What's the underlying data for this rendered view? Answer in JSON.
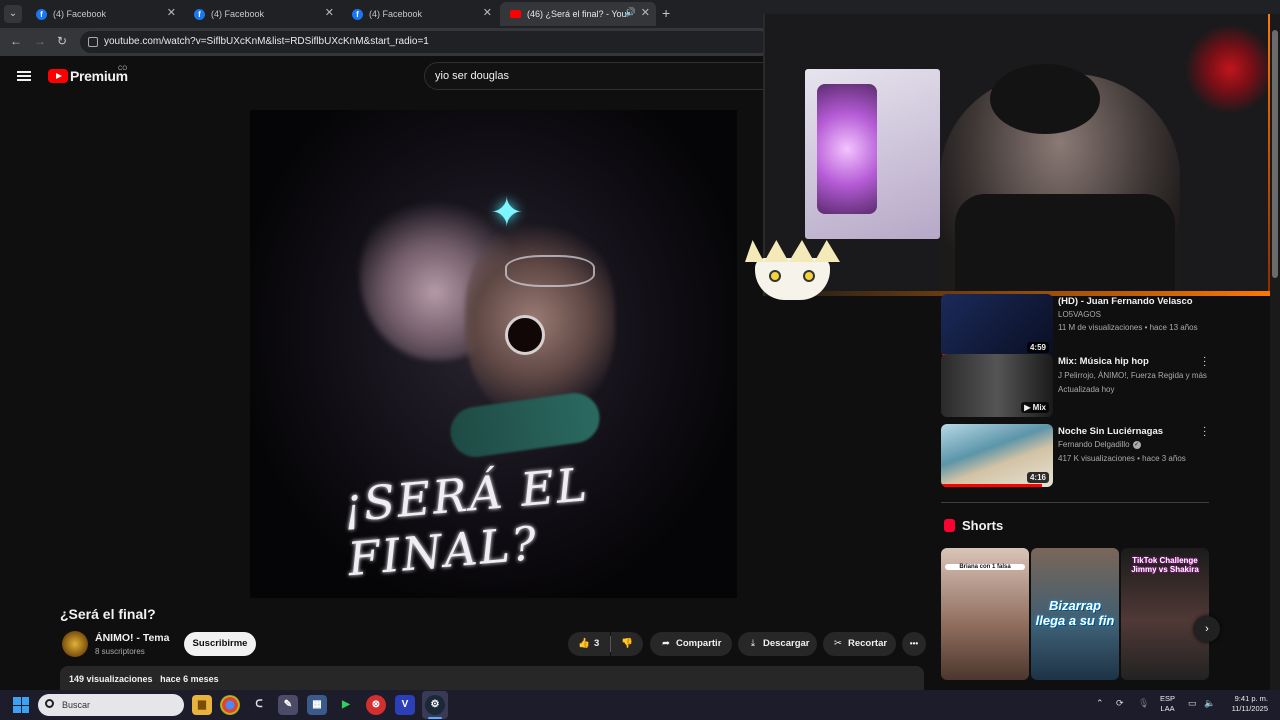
{
  "browser": {
    "tabs": [
      {
        "title": "(4) Facebook",
        "favicon": "facebook-icon",
        "active": false
      },
      {
        "title": "(4) Facebook",
        "favicon": "facebook-icon",
        "active": false
      },
      {
        "title": "(4) Facebook",
        "favicon": "facebook-icon",
        "active": false
      },
      {
        "title": "(46) ¿Será el final? - YouTube",
        "favicon": "youtube-icon",
        "active": true
      }
    ],
    "new_tab": "+",
    "url": "youtube.com/watch?v=SiflbUXcKnM&list=RDSiflbUXcKnM&start_radio=1"
  },
  "youtube": {
    "logo_text": "Premium",
    "country": "CO",
    "search_query": "yio ser douglas",
    "brand_color": "#ff0000"
  },
  "video": {
    "art_text": "¡SERÁ EL FINAL?",
    "title": "¿Será el final?",
    "channel": "ÁNIMO! - Tema",
    "subscribers": "8 suscriptores",
    "subscribe_label": "Suscribirme",
    "likes": "3",
    "share_label": "Compartir",
    "download_label": "Descargar",
    "clip_label": "Recortar",
    "more_label": "•••",
    "views": "149 visualizaciones",
    "published": "hace 6 meses"
  },
  "sidebar": {
    "recommendations": [
      {
        "title": "(HD) - Juan Fernando Velasco",
        "channel": "LO5VAGOS",
        "meta": "11 M de visualizaciones • hace 13 años",
        "duration": "4:59",
        "progress": 0.7
      },
      {
        "title": "Mix: Música hip hop",
        "channel": "J Pelirrojo, ÁNIMO!, Fuerza Regida y más",
        "meta": "Actualizada hoy",
        "duration": "Mix",
        "progress": 0
      },
      {
        "title": "Noche Sin Luciérnagas",
        "channel": "Fernando Delgadillo",
        "meta": "417 K visualizaciones • hace 3 años",
        "duration": "4:16",
        "progress": 0.9
      }
    ],
    "shorts_title": "Shorts",
    "shorts": [
      {
        "caption": "Briana con 1 falsa"
      },
      {
        "caption": "Bizarrap llega a su fin"
      },
      {
        "caption": "TikTok Challenge Jimmy vs Shakira"
      }
    ]
  },
  "taskbar": {
    "search_placeholder": "Buscar",
    "language": "ESP",
    "layout": "LAA",
    "time": "9:41 p. m.",
    "date": "11/11/2025"
  }
}
